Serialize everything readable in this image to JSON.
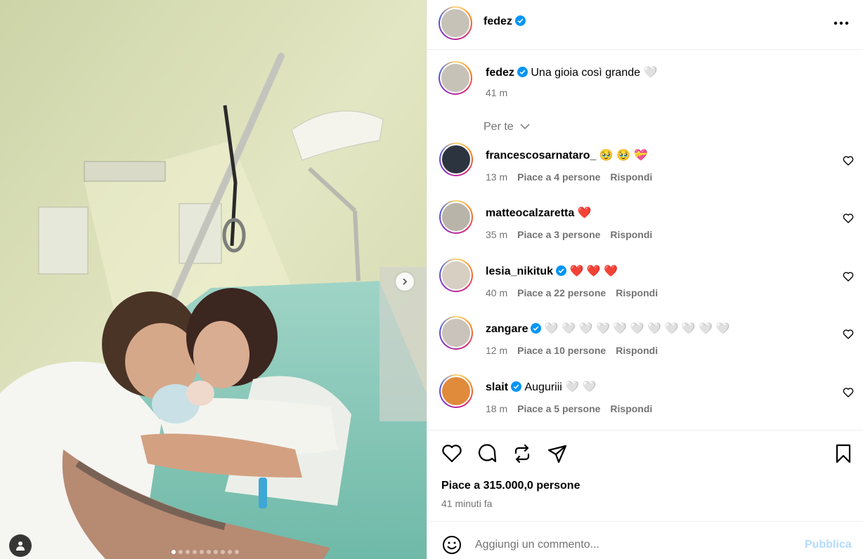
{
  "post": {
    "username": "fedez",
    "caption": "Una gioia così grande",
    "caption_emoji": "🤍",
    "caption_time": "41 m",
    "likes": "Piace a 315.000,0 persone",
    "time_ago": "41 minuti fa",
    "carousel": {
      "total": 10,
      "active": 1
    }
  },
  "sort_label": "Per te",
  "comments": [
    {
      "user": "francescosarnataro_",
      "verified": false,
      "text": "🥹 🥹 💝",
      "time": "13 m",
      "likes": "Piace a 4 persone",
      "reply": "Rispondi",
      "avatar_color": "#2c3440"
    },
    {
      "user": "matteocalzaretta",
      "verified": false,
      "text": "❤️",
      "time": "35 m",
      "likes": "Piace a 3 persone",
      "reply": "Rispondi",
      "avatar_color": "#b9b4aa"
    },
    {
      "user": "lesia_nikituk",
      "verified": true,
      "text": "❤️ ❤️ ❤️",
      "time": "40 m",
      "likes": "Piace a 22 persone",
      "reply": "Rispondi",
      "avatar_color": "#d8cfc3"
    },
    {
      "user": "zangare",
      "verified": true,
      "text": "🤍 🤍 🤍 🤍 🤍 🤍 🤍 🤍 🤍 🤍 🤍",
      "time": "12 m",
      "likes": "Piace a 10 persone",
      "reply": "Rispondi",
      "avatar_color": "#c9c3bb"
    },
    {
      "user": "slait",
      "verified": true,
      "text": "Auguriii 🤍 🤍",
      "time": "18 m",
      "likes": "Piace a 5 persone",
      "reply": "Rispondi",
      "avatar_color": "#e08a3c"
    }
  ],
  "composer": {
    "placeholder": "Aggiungi un commento...",
    "publish": "Pubblica"
  },
  "colors": {
    "verified": "#0095f6",
    "muted": "#737373",
    "publish": "#b3dbff",
    "divider": "#efefef"
  },
  "icons": [
    "more-icon",
    "heart-icon",
    "comment-icon",
    "share-icon",
    "send-icon",
    "save-icon",
    "emoji-icon",
    "chevron-down-icon",
    "chevron-right-icon",
    "user-tag-icon",
    "verified-icon"
  ]
}
